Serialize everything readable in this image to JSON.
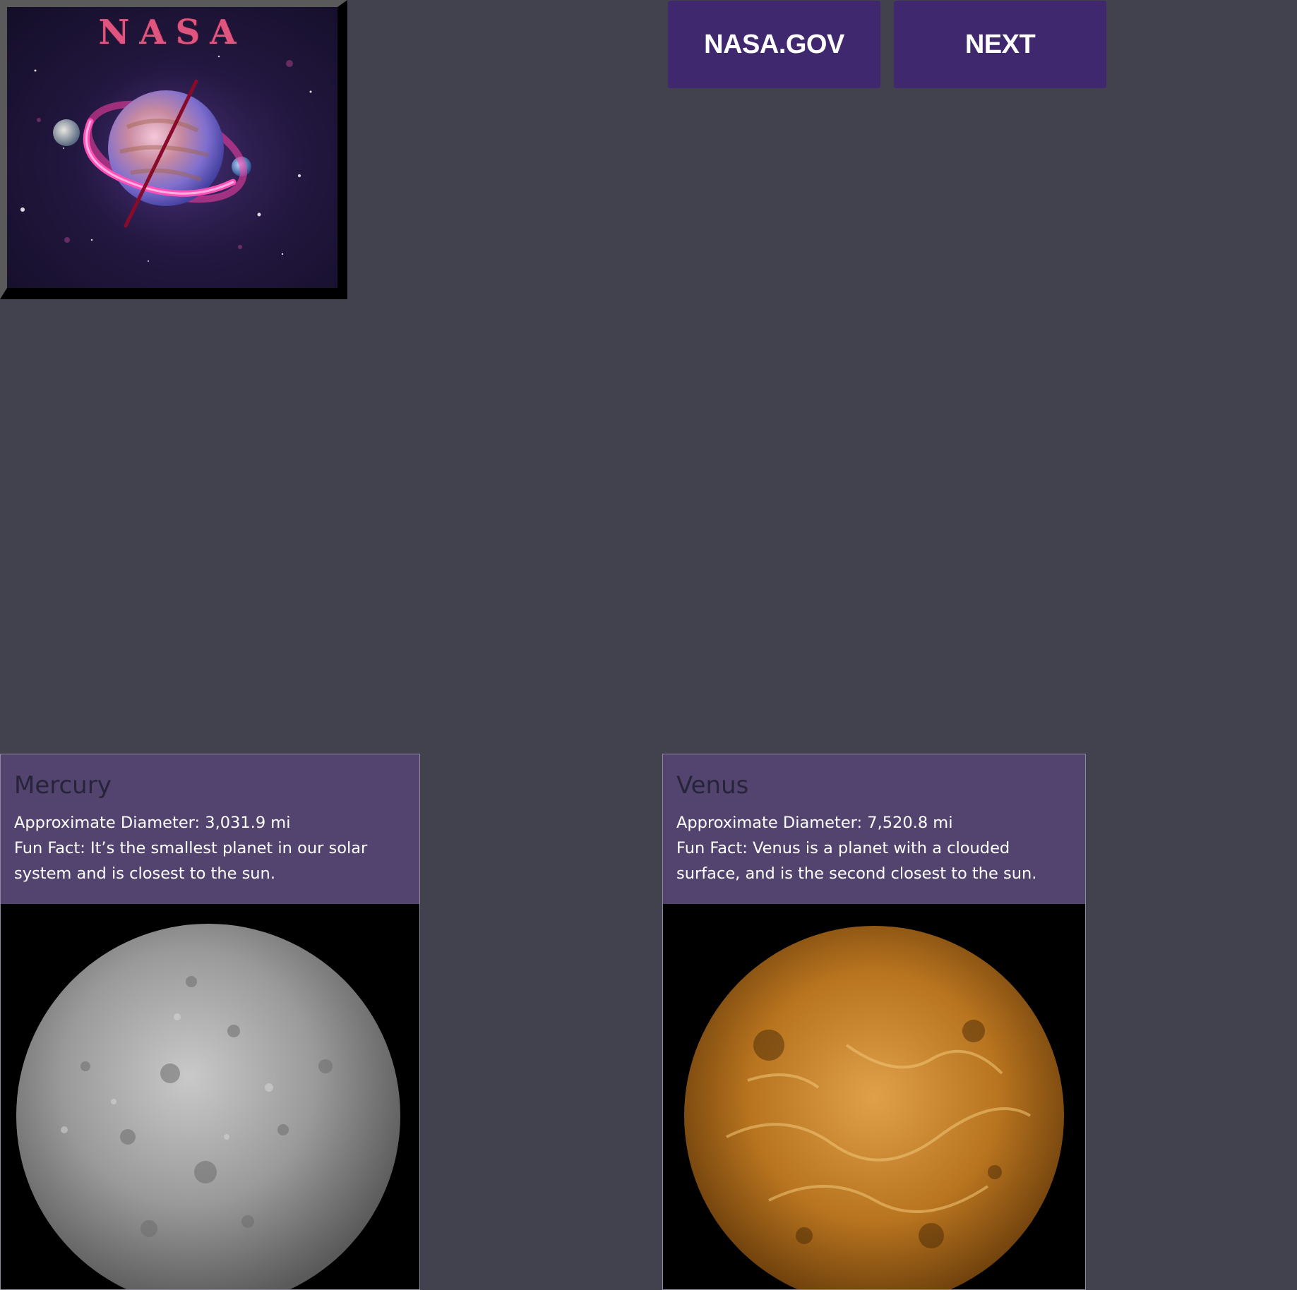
{
  "logo": {
    "title": "NASA",
    "icon": "planet-with-ring-logo"
  },
  "nav": {
    "nasa_gov_label": "NASA.GOV",
    "next_label": "NEXT"
  },
  "planets": [
    {
      "name": "Mercury",
      "diameter": "Approximate Diameter: 3,031.9 mi",
      "fact": "Fun Fact: It’s the smallest planet in our solar system and is closest to the sun.",
      "image": "mercury-image"
    },
    {
      "name": "Venus",
      "diameter": "Approximate Diameter: 7,520.8 mi",
      "fact": "Fun Fact: Venus is a planet with a clouded surface, and is the second closest to the sun.",
      "image": "venus-image"
    }
  ],
  "colors": {
    "page_background": "#42424f",
    "button_background": "#40286f",
    "card_header_background": "#53446f",
    "logo_title": "#e0557f"
  }
}
